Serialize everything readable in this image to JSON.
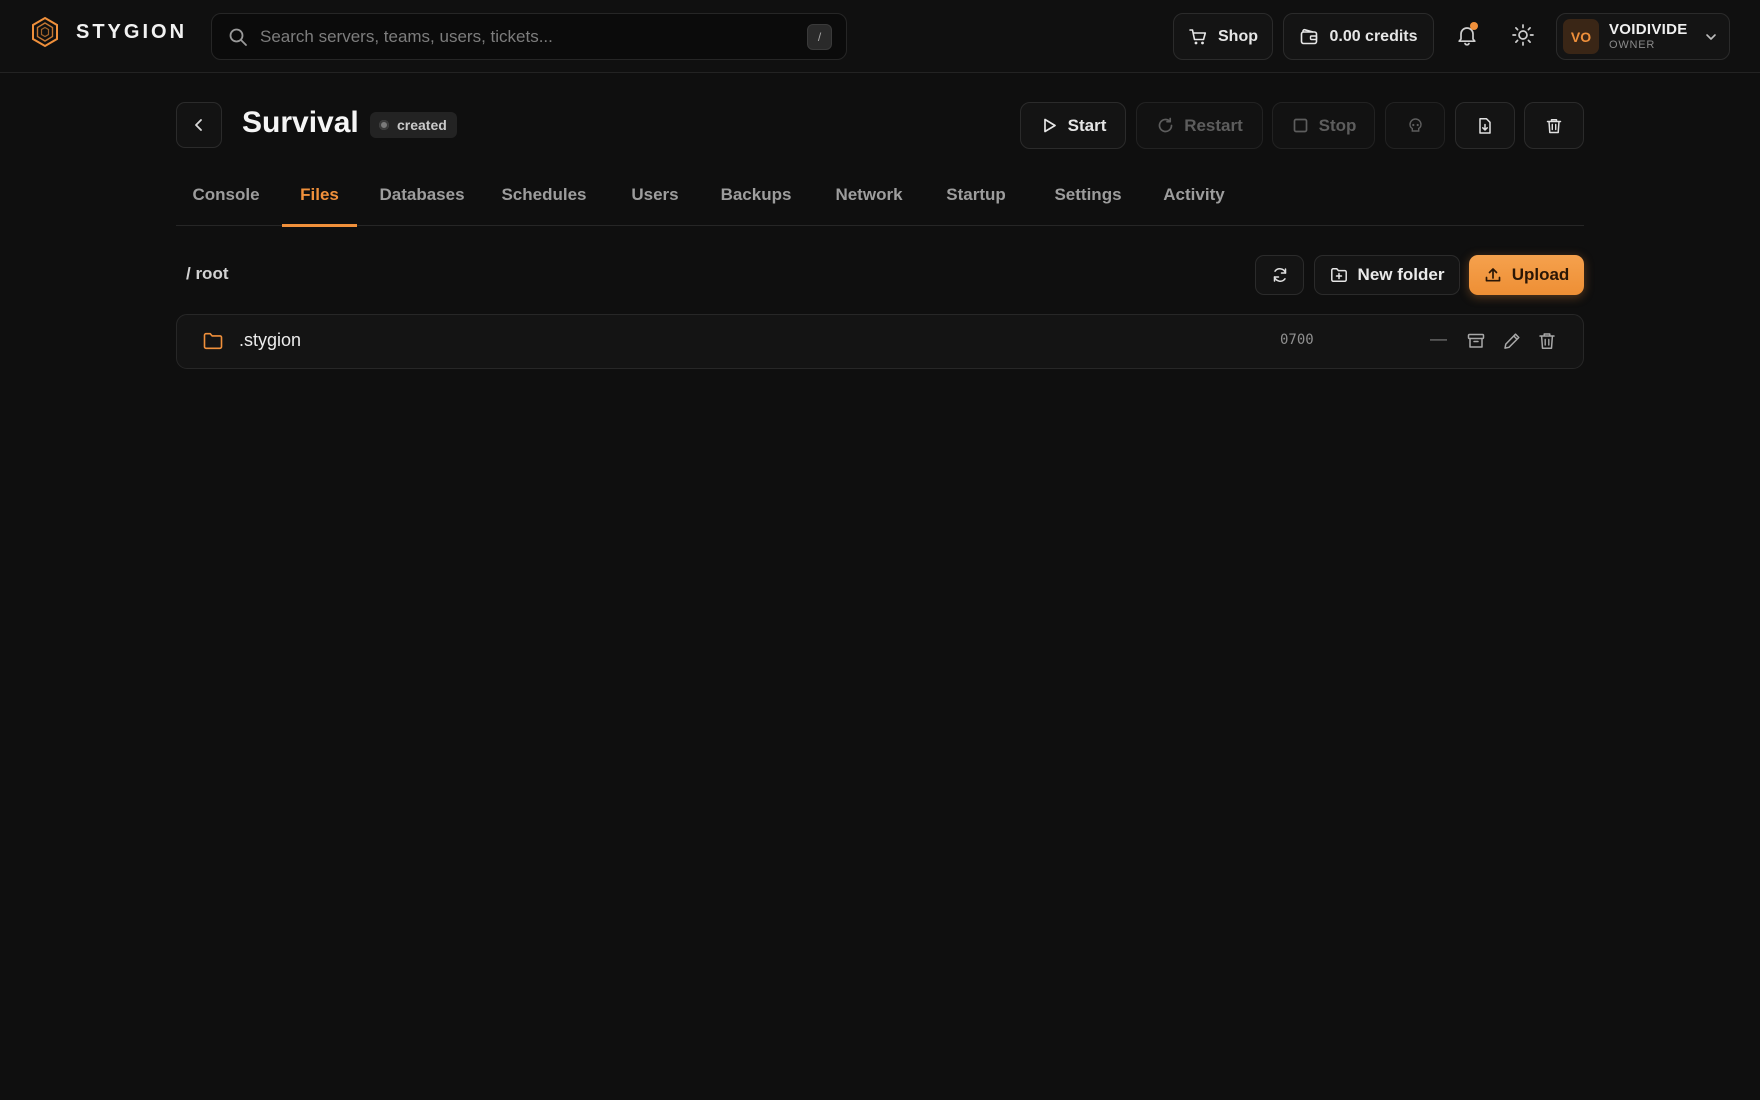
{
  "brand": {
    "name": "STYGION"
  },
  "search": {
    "placeholder": "Search servers, teams, users, tickets...",
    "shortcut": "/"
  },
  "topbar": {
    "shop_label": "Shop",
    "credits_label": "0.00 credits",
    "has_notification": true
  },
  "user": {
    "initials": "VO",
    "name": "VOIDIVIDE",
    "role": "OWNER"
  },
  "server": {
    "name": "Survival",
    "status": "created",
    "actions": {
      "start": "Start",
      "restart": "Restart",
      "stop": "Stop"
    }
  },
  "tabs": [
    {
      "label": "Console"
    },
    {
      "label": "Files",
      "active": true
    },
    {
      "label": "Databases"
    },
    {
      "label": "Schedules"
    },
    {
      "label": "Users"
    },
    {
      "label": "Backups"
    },
    {
      "label": "Network"
    },
    {
      "label": "Startup"
    },
    {
      "label": "Settings"
    },
    {
      "label": "Activity"
    }
  ],
  "files": {
    "breadcrumb": "/ root",
    "new_folder_label": "New folder",
    "upload_label": "Upload",
    "items": [
      {
        "name": ".stygion",
        "type": "folder",
        "permissions": "0700",
        "size": "—"
      }
    ]
  },
  "colors": {
    "accent": "#f0903b",
    "background": "#0f0f0f",
    "surface": "#141414",
    "border": "#2b2b2b"
  }
}
